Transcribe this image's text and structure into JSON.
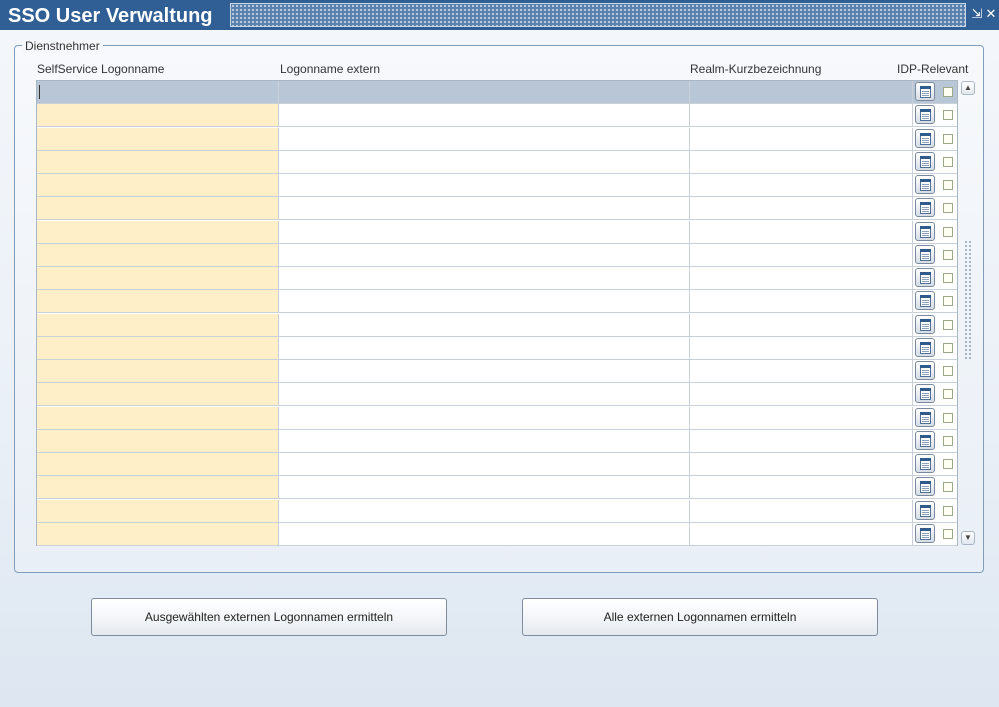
{
  "window": {
    "title": "SSO User Verwaltung",
    "minimize_glyph": "⇲",
    "close_glyph": "✕"
  },
  "group": {
    "legend": "Dienstnehmer"
  },
  "table": {
    "columns": [
      "SelfService Logonname",
      "Logonname extern",
      "Realm-Kurzbezeichnung",
      "IDP-Relevant"
    ],
    "row_count": 20,
    "selected_row": 0
  },
  "scrollbar": {
    "up_glyph": "▲",
    "down_glyph": "▼"
  },
  "buttons": {
    "selected": "Ausgewählten externen Logonnamen ermitteln",
    "all": "Alle externen Logonnamen ermitteln"
  },
  "colors": {
    "titlebar": "#2f5f95",
    "first_column": "#feefc9",
    "selected_row": "#b9c6d6"
  }
}
